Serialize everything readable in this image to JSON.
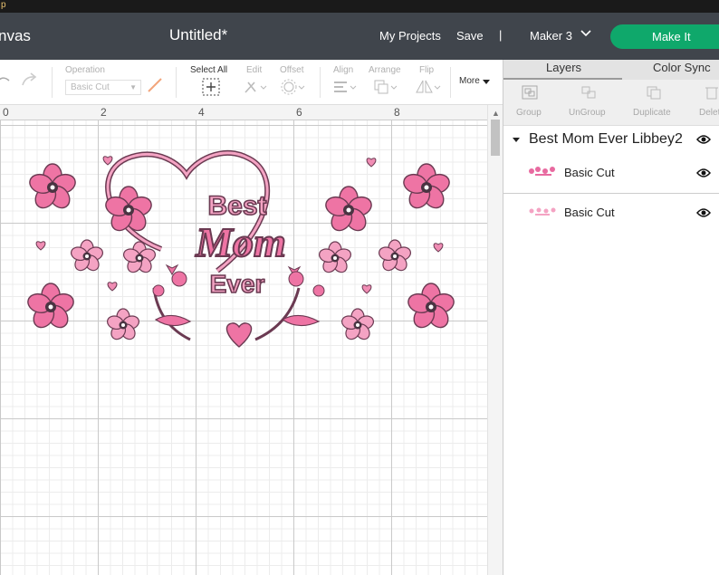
{
  "titlebar": {
    "text": "p"
  },
  "header": {
    "app_name": "nvas",
    "document_title": "Untitled*",
    "my_projects": "My Projects",
    "save": "Save",
    "separator": "|",
    "machine": "Maker 3",
    "make_it": "Make It"
  },
  "toolbar": {
    "operation_label": "Operation",
    "operation_value": "Basic Cut",
    "select_all": "Select All",
    "edit": "Edit",
    "offset": "Offset",
    "align": "Align",
    "arrange": "Arrange",
    "flip": "Flip",
    "more": "More"
  },
  "ruler": {
    "numbers": [
      "0",
      "2",
      "4",
      "6",
      "8"
    ]
  },
  "canvas_art": {
    "texts": [
      "Best",
      "Mom",
      "Ever"
    ],
    "colors": {
      "pink": "#ee74a4",
      "light_pink": "#f4a3c3",
      "outline": "#6b3a52",
      "center": "#4a3442"
    }
  },
  "panel": {
    "tabs": [
      "Layers",
      "Color Sync"
    ],
    "actions": [
      "Group",
      "UnGroup",
      "Duplicate",
      "Delete"
    ],
    "group_name": "Best Mom Ever Libbey2",
    "layers": [
      {
        "name": "Basic Cut"
      },
      {
        "name": "Basic Cut"
      }
    ]
  },
  "colors": {
    "header_bg": "#40454c",
    "accent": "#0fa86b"
  }
}
